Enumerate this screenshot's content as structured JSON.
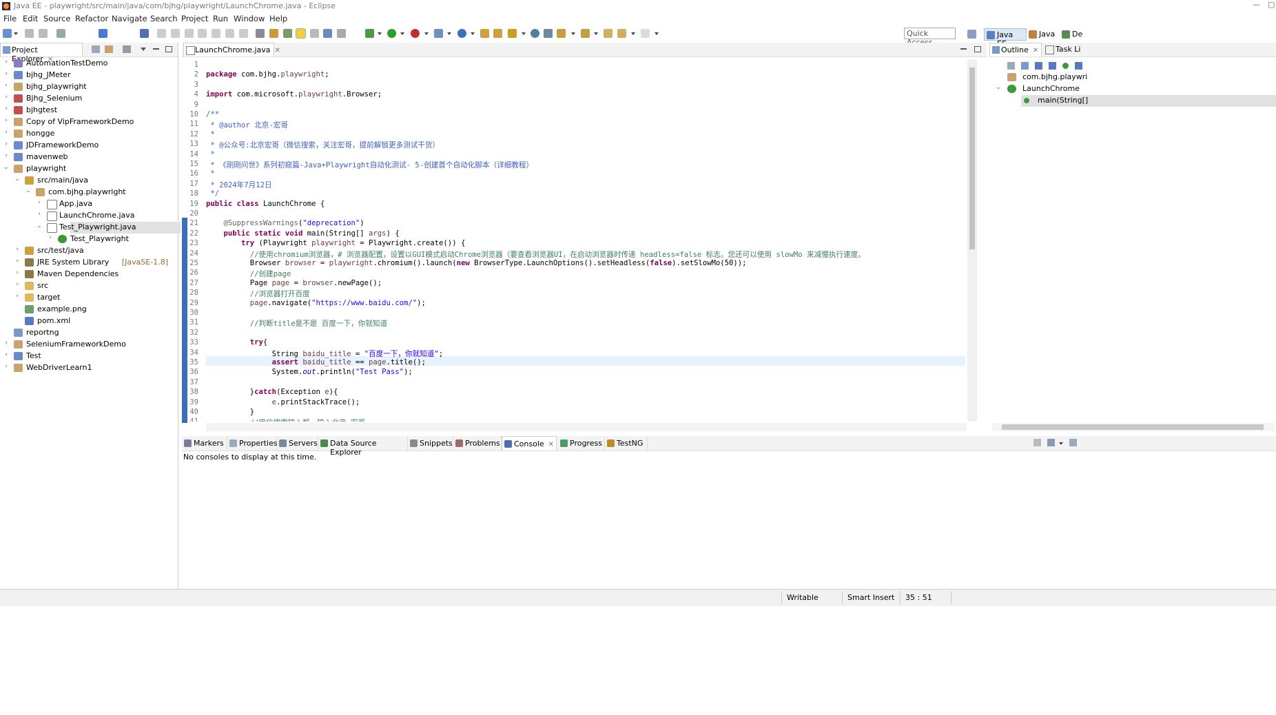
{
  "window": {
    "title": "Java EE - playwright/src/main/java/com/bjhg/playwright/LaunchChrome.java - Eclipse",
    "minimize": "—",
    "restore": "▢"
  },
  "menu": [
    "File",
    "Edit",
    "Source",
    "Refactor",
    "Navigate",
    "Search",
    "Project",
    "Run",
    "Window",
    "Help"
  ],
  "toolbar": {
    "quick_access": "Quick Access",
    "perspectives": [
      "Java EE",
      "Java",
      "De"
    ]
  },
  "project_explorer": {
    "title": "Project Explorer",
    "items": [
      {
        "label": "AutomationTestDemo",
        "expanded": false
      },
      {
        "label": "bjhg_JMeter",
        "expanded": false
      },
      {
        "label": "bjhg_playwright",
        "expanded": false
      },
      {
        "label": "Bjhg_Selenium",
        "expanded": false
      },
      {
        "label": "bjhgtest",
        "expanded": false
      },
      {
        "label": "Copy of VipFrameworkDemo",
        "expanded": false
      },
      {
        "label": "hongge",
        "expanded": false
      },
      {
        "label": "JDFrameworkDemo",
        "expanded": false
      },
      {
        "label": "mavenweb",
        "expanded": false
      },
      {
        "label": "playwright",
        "expanded": true
      },
      {
        "label": "src/main/java",
        "expanded": true
      },
      {
        "label": "com.bjhg.playwright",
        "expanded": true
      },
      {
        "label": "App.java",
        "expanded": false
      },
      {
        "label": "LaunchChrome.java",
        "expanded": false
      },
      {
        "label": "Test_Playwright.java",
        "expanded": true
      },
      {
        "label": "Test_Playwright",
        "expanded": false
      },
      {
        "label": "src/test/java",
        "expanded": false
      },
      {
        "label": "JRE System Library",
        "suffix": "[JavaSE-1.8]",
        "expanded": false
      },
      {
        "label": "Maven Dependencies",
        "expanded": false
      },
      {
        "label": "src",
        "expanded": false
      },
      {
        "label": "target",
        "expanded": false
      },
      {
        "label": "example.png",
        "expanded": false
      },
      {
        "label": "pom.xml",
        "expanded": false
      },
      {
        "label": "reportng",
        "expanded": false
      },
      {
        "label": "SeleniumFrameworkDemo",
        "expanded": false
      },
      {
        "label": "Test",
        "expanded": false
      },
      {
        "label": "WebDriverLearn1",
        "expanded": false
      }
    ]
  },
  "editor": {
    "tab": "LaunchChrome.java",
    "lines": [
      {
        "n": "1",
        "t": ""
      },
      {
        "n": "2",
        "t": "package com.bjhg.playwright;"
      },
      {
        "n": "3",
        "t": ""
      },
      {
        "n": "4",
        "t": "import com.microsoft.playwright.Browser;"
      },
      {
        "n": "9",
        "t": ""
      },
      {
        "n": "10",
        "t": "/**"
      },
      {
        "n": "11",
        "t": " * @author 北京-宏哥"
      },
      {
        "n": "12",
        "t": " *"
      },
      {
        "n": "13",
        "t": " * @公众号:北京宏哥（微信搜索，关注宏哥，提前解锁更多测试干货）"
      },
      {
        "n": "14",
        "t": " *"
      },
      {
        "n": "15",
        "t": " * 《刚刚问世》系列初窥篇-Java+Playwright自动化测试- 5-创建首个自动化脚本（详细教程）"
      },
      {
        "n": "16",
        "t": " *"
      },
      {
        "n": "17",
        "t": " * 2024年7月12日"
      },
      {
        "n": "18",
        "t": " */"
      },
      {
        "n": "19",
        "t": "public class LaunchChrome {"
      },
      {
        "n": "20",
        "t": ""
      },
      {
        "n": "21",
        "t": "    @SuppressWarnings(\"deprecation\")"
      },
      {
        "n": "22",
        "t": "    public static void main(String[] args) {"
      },
      {
        "n": "23",
        "t": "        try (Playwright playwright = Playwright.create()) {"
      },
      {
        "n": "24",
        "t": "          //使用chromium浏览器，# 浏览器配置，设置以GUI模式启动Chrome浏览器（要查看浏览器UI，在启动浏览器时传递 headless=false 标志。您还可以使用 slowMo 来减慢执行速度。"
      },
      {
        "n": "25",
        "t": "          Browser browser = playwright.chromium().launch(new BrowserType.LaunchOptions().setHeadless(false).setSlowMo(50));"
      },
      {
        "n": "26",
        "t": "          //创建page"
      },
      {
        "n": "27",
        "t": "          Page page = browser.newPage();"
      },
      {
        "n": "28",
        "t": "          //浏览器打开百度"
      },
      {
        "n": "29",
        "t": "          page.navigate(\"https://www.baidu.com/\");"
      },
      {
        "n": "30",
        "t": ""
      },
      {
        "n": "31",
        "t": "          //判断title是不是 百度一下，你就知道"
      },
      {
        "n": "32",
        "t": ""
      },
      {
        "n": "33",
        "t": "          try{"
      },
      {
        "n": "34",
        "t": "               String baidu_title = \"百度一下，你就知道\";"
      },
      {
        "n": "35",
        "t": "               assert baidu_title == page.title();"
      },
      {
        "n": "36",
        "t": "               System.out.println(\"Test Pass\");"
      },
      {
        "n": "37",
        "t": ""
      },
      {
        "n": "38",
        "t": "          }catch(Exception e){"
      },
      {
        "n": "39",
        "t": "               e.printStackTrace();"
      },
      {
        "n": "40",
        "t": "          }"
      },
      {
        "n": "41",
        "t": "          //定位搜索输入框，输入北京-宏哥"
      }
    ]
  },
  "outline": {
    "tab": "Outline",
    "tab2": "Task Li",
    "items": [
      "com.bjhg.playwri",
      "LaunchChrome",
      "main(String[]"
    ]
  },
  "bottom": {
    "tabs": [
      "Markers",
      "Properties",
      "Servers",
      "Data Source Explorer",
      "Snippets",
      "Problems",
      "Console",
      "Progress",
      "TestNG"
    ],
    "console_message": "No consoles to display at this time."
  },
  "status": {
    "writable": "Writable",
    "insert_mode": "Smart Insert",
    "position": "35 : 51"
  },
  "colors": {
    "keyword": "#7f0055",
    "string": "#2a00ff",
    "comment": "#3f7f5f",
    "javadoc": "#3f5fbf",
    "selection": "#e1e1e1",
    "current_line": "#e8f2fe"
  }
}
